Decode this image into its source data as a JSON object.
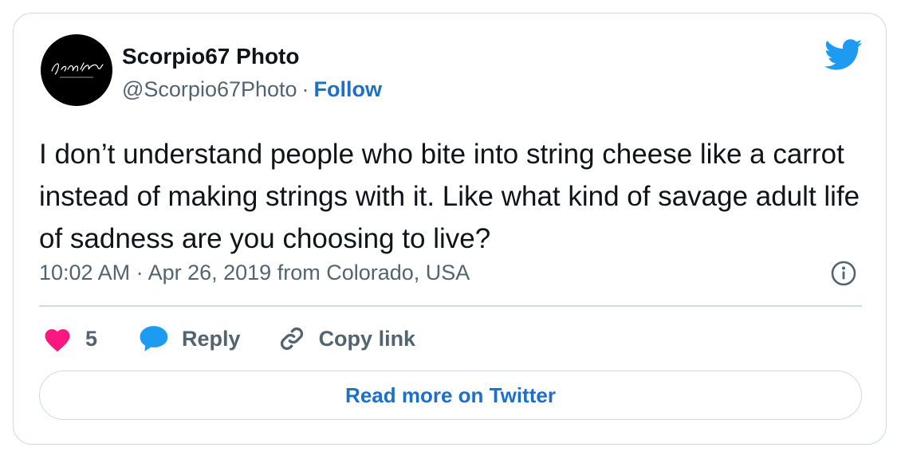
{
  "author": {
    "name": "Scorpio67 Photo",
    "handle": "@Scorpio67Photo",
    "separator": "·",
    "follow_label": "Follow",
    "avatar_logo_text": "Scorpio67 Photography"
  },
  "tweet": {
    "text": "I don’t understand people who bite into string cheese like a carrot instead of making strings with it. Like what kind of savage adult life of sadness are you choosing to live?",
    "timestamp": "10:02 AM · Apr 26, 2019 from Colorado, USA"
  },
  "actions": {
    "like_count": "5",
    "reply_label": "Reply",
    "copy_link_label": "Copy link"
  },
  "read_more_label": "Read more on Twitter",
  "icons": {
    "brand": "twitter-bird-icon",
    "info": "info-icon",
    "like": "heart-icon",
    "reply": "speech-bubble-icon",
    "copy_link": "link-icon"
  },
  "colors": {
    "accent": "#1d9bf0",
    "link": "#1d70c9",
    "heart": "#f91880",
    "muted": "#536471",
    "border": "#cfd9de"
  }
}
